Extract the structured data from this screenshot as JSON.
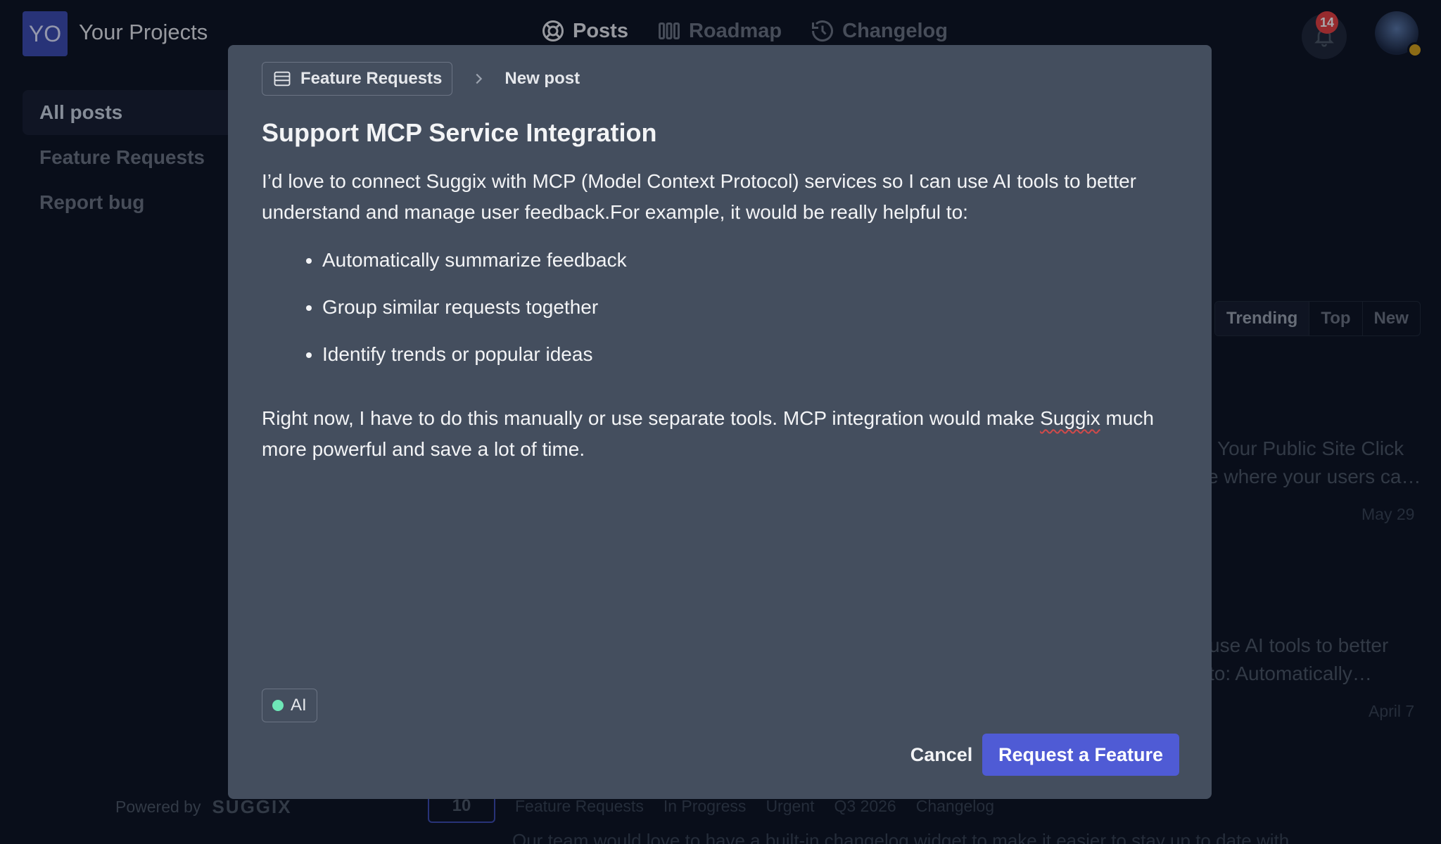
{
  "header": {
    "project_logo": "YO",
    "project_title": "Your Projects",
    "nav": [
      {
        "label": "Posts",
        "icon": "lifebuoy-icon"
      },
      {
        "label": "Roadmap",
        "icon": "roadmap-icon"
      },
      {
        "label": "Changelog",
        "icon": "history-icon"
      }
    ],
    "notification_count": "14"
  },
  "sidebar": {
    "items": [
      {
        "label": "All posts"
      },
      {
        "label": "Feature Requests"
      },
      {
        "label": "Report bug"
      }
    ],
    "powered_by": "Powered by",
    "brand": "SUGGIX"
  },
  "sort": {
    "tabs": [
      "Trending",
      "Top",
      "New"
    ]
  },
  "background_posts": [
    {
      "line1": "Your Public Site Click",
      "line2": "e where your users ca…",
      "date": "May 29"
    },
    {
      "line1": "use AI tools to better",
      "line2": "to: Automatically…",
      "date": "April 7"
    }
  ],
  "background_bottom": {
    "votes": "10",
    "board": "Feature Requests",
    "status": "In Progress",
    "priority": "Urgent",
    "eta": "Q3 2026",
    "tag": "Changelog",
    "snippet": "Our team would love to have a built-in changelog widget to make it easier to stay up to date with"
  },
  "modal": {
    "breadcrumb_board": "Feature Requests",
    "breadcrumb_current": "New post",
    "title": "Support MCP Service Integration",
    "intro_line1": "I’d love to connect Suggix with MCP (Model Context Protocol) services so I can use AI tools to better",
    "intro_line2": "understand and manage user feedback.For example, it would be really helpful to:",
    "bullets": [
      "Automatically summarize feedback",
      "Group similar requests together",
      "Identify trends or popular ideas"
    ],
    "closing_before": "Right now, I have to do this manually or use separate tools. MCP integration would make ",
    "closing_flagged": "Suggix",
    "closing_after": " much",
    "closing_line2": "more powerful and save a lot of time.",
    "ai_label": "AI",
    "cancel_label": "Cancel",
    "submit_label": "Request a Feature"
  }
}
